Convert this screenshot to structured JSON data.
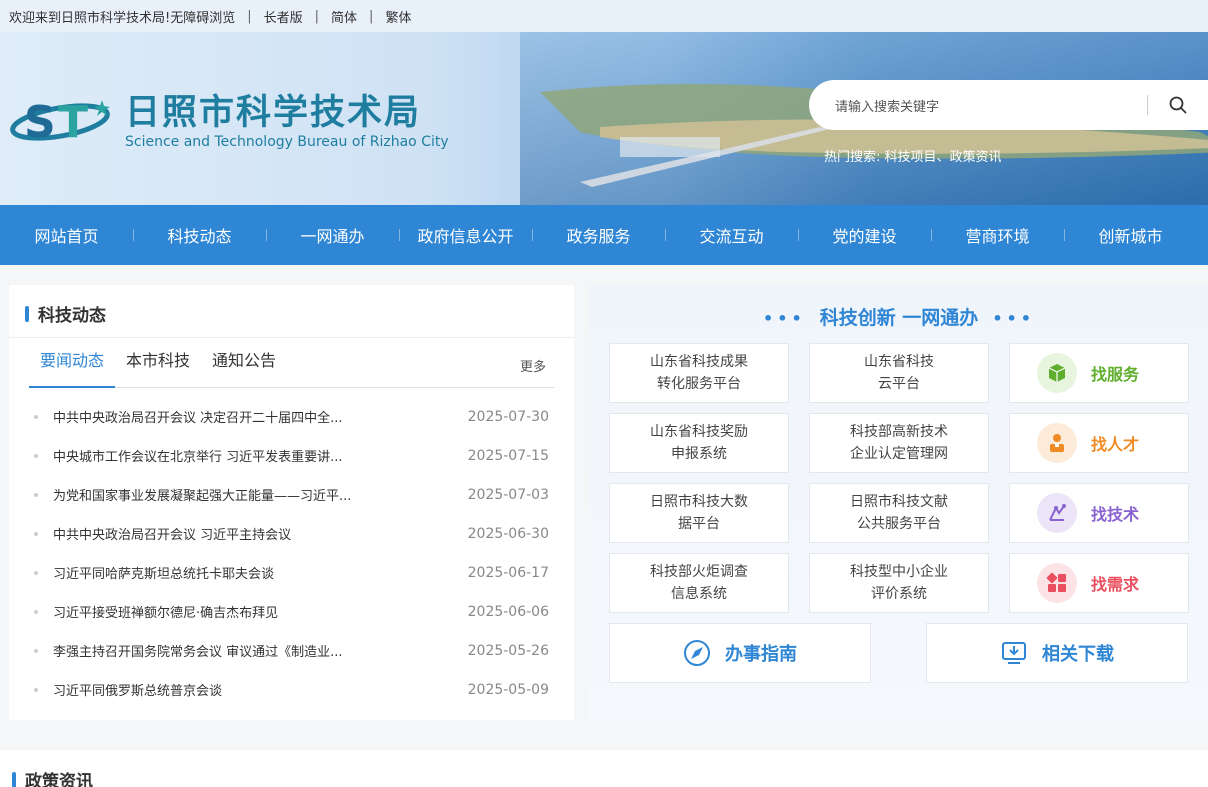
{
  "topbar": {
    "welcome": "欢迎来到日照市科学技术局!",
    "accessible": "无障碍浏览",
    "elder": "长者版",
    "simplified": "简体",
    "traditional": "繁体"
  },
  "header": {
    "title_cn": "日照市科学技术局",
    "title_en": "Science and Technology Bureau of Rizhao City",
    "search_placeholder": "请输入搜索关键字",
    "hot_search": "热门搜索: 科技项目、政策资讯"
  },
  "nav": {
    "items": [
      "网站首页",
      "科技动态",
      "一网通办",
      "政府信息公开",
      "政务服务",
      "交流互动",
      "党的建设",
      "营商环境",
      "创新城市"
    ]
  },
  "news": {
    "title": "科技动态",
    "tabs": [
      "要闻动态",
      "本市科技",
      "通知公告"
    ],
    "more": "更多",
    "items": [
      {
        "title": "中共中央政治局召开会议 决定召开二十届四中全...",
        "date": "2025-07-30"
      },
      {
        "title": "中央城市工作会议在北京举行 习近平发表重要讲...",
        "date": "2025-07-15"
      },
      {
        "title": "为党和国家事业发展凝聚起强大正能量——习近平...",
        "date": "2025-07-03"
      },
      {
        "title": "中共中央政治局召开会议 习近平主持会议",
        "date": "2025-06-30"
      },
      {
        "title": "习近平同哈萨克斯坦总统托卡耶夫会谈",
        "date": "2025-06-17"
      },
      {
        "title": "习近平接受班禅额尔德尼·确吉杰布拜见",
        "date": "2025-06-06"
      },
      {
        "title": "李强主持召开国务院常务会议 审议通过《制造业...",
        "date": "2025-05-26"
      },
      {
        "title": "习近平同俄罗斯总统普京会谈",
        "date": "2025-05-09"
      }
    ]
  },
  "service": {
    "title": "科技创新 一网通办",
    "platforms": [
      {
        "line1": "山东省科技成果",
        "line2": "转化服务平台"
      },
      {
        "line1": "山东省科技",
        "line2": "云平台"
      },
      {
        "line1": "山东省科技奖励",
        "line2": "申报系统"
      },
      {
        "line1": "科技部高新技术",
        "line2": "企业认定管理网"
      },
      {
        "line1": "日照市科技大数",
        "line2": "据平台"
      },
      {
        "line1": "日照市科技文献",
        "line2": "公共服务平台"
      },
      {
        "line1": "科技部火炬调查",
        "line2": "信息系统"
      },
      {
        "line1": "科技型中小企业",
        "line2": "评价系统"
      }
    ],
    "finds": [
      {
        "label": "找服务",
        "icon": "cube-icon",
        "color": "#5fae2e",
        "bg": "#e8f5de"
      },
      {
        "label": "找人才",
        "icon": "person-icon",
        "color": "#f08a24",
        "bg": "#fdebd9"
      },
      {
        "label": "找技术",
        "icon": "tech-icon",
        "color": "#8a63d2",
        "bg": "#ece5f8"
      },
      {
        "label": "找需求",
        "icon": "grid-icon",
        "color": "#ea4f5f",
        "bg": "#fce3e5"
      }
    ],
    "guide": "办事指南",
    "download": "相关下载"
  },
  "policy": {
    "title": "政策资讯"
  },
  "colors": {
    "primary": "#2f86d4",
    "logo": "#1f7ea0"
  }
}
